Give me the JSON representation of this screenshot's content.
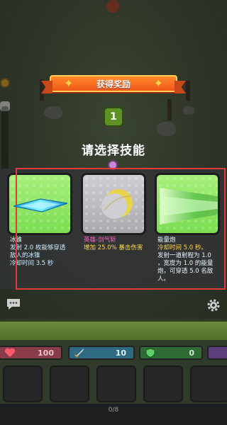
{
  "reward": {
    "title": "获得奖励",
    "count": "1"
  },
  "prompt": "请选择技能",
  "skills": [
    {
      "name": "冰锥",
      "line1": "发射 2.0 枚能够穿透",
      "line2": "敌人的冰锥",
      "line3": "冷却时间 3.5 秒",
      "card_color": "green",
      "icon": "ice-spike-icon"
    },
    {
      "name": "英雄-剑气斩",
      "line1": "增加 25.0% 暴击伤害",
      "card_color": "gray",
      "icon": "sword-slash-icon",
      "name_color": "#ff5ec8",
      "text_color": "#ffd84a"
    },
    {
      "name": "能量炮",
      "line1": "冷却时间 5.0 秒。",
      "line2": "发射一道射程为 1.0",
      "line3": "，宽度为 1.0 的能量",
      "line4": "炮，可穿透 5.0 名敌",
      "line5": "人。",
      "card_color": "green",
      "icon": "energy-cannon-icon",
      "first_line_color": "#ffd84a"
    }
  ],
  "stats": {
    "hp": "100",
    "attack": "10",
    "defense": "0"
  },
  "footer": "0/8",
  "colors": {
    "highlight": "#e03a3a",
    "ribbon": "#f0571a",
    "card_green": "#7cdc52",
    "card_gray": "#a9a9ae"
  }
}
